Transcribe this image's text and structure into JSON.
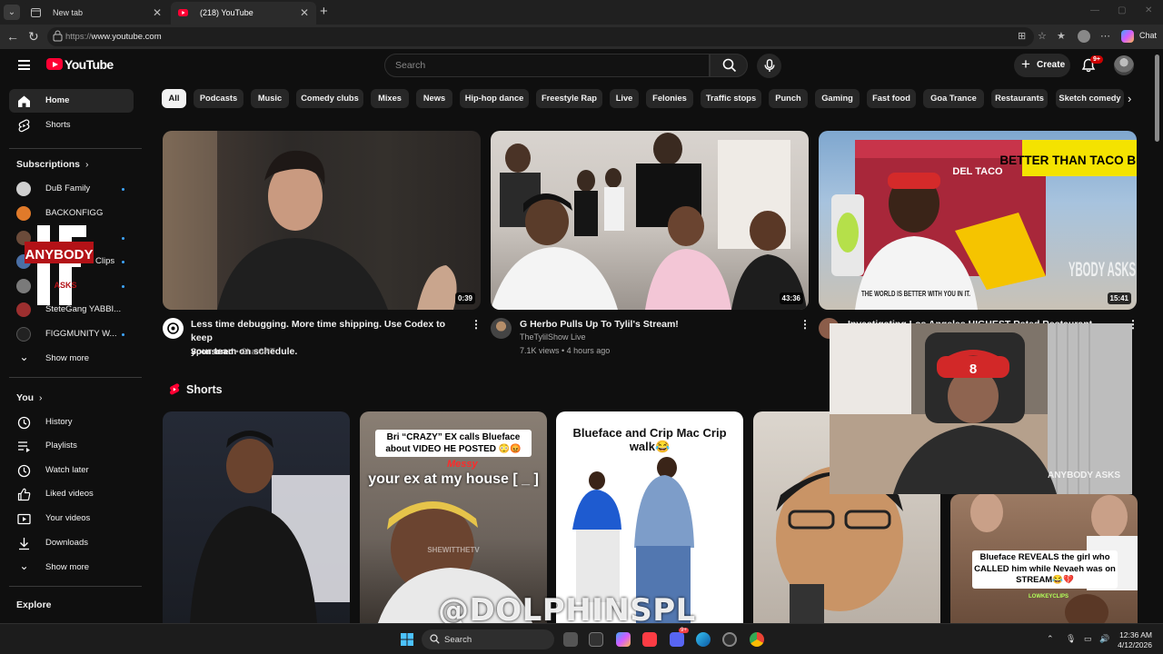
{
  "browser": {
    "tabs": [
      {
        "label": "New tab",
        "active": false
      },
      {
        "label": "(218) YouTube",
        "active": true
      }
    ],
    "url_scheme": "https://",
    "url_host": "www.youtube.com",
    "chat_label": "Chat"
  },
  "header": {
    "logo_text": "YouTube",
    "search_placeholder": "Search",
    "create_label": "Create",
    "notification_badge": "9+"
  },
  "sidebar": {
    "main": [
      {
        "label": "Home",
        "icon": "home-icon",
        "active": true
      },
      {
        "label": "Shorts",
        "icon": "shorts-icon",
        "active": false
      }
    ],
    "subscriptions_heading": "Subscriptions",
    "subscriptions": [
      {
        "label": "DuB Family",
        "color": "#c8c8c8"
      },
      {
        "label": "BACKONFIGG",
        "color": "#e07a2a"
      },
      {
        "label": "",
        "color": "#6b4b3a"
      },
      {
        "label": "Clips",
        "color": "#4a6fa5"
      },
      {
        "label": "",
        "color": "#7a7a7a"
      },
      {
        "label": "SteteGang YABBI...",
        "color": "#9c2f2f"
      },
      {
        "label": "FIGGMUNITY W...",
        "color": "#222222"
      }
    ],
    "subs_show_more": "Show more",
    "you_heading": "You",
    "you_items": [
      {
        "label": "History",
        "icon": "history-icon"
      },
      {
        "label": "Playlists",
        "icon": "playlists-icon"
      },
      {
        "label": "Watch later",
        "icon": "watch-later-icon"
      },
      {
        "label": "Liked videos",
        "icon": "thumbs-up-icon"
      },
      {
        "label": "Your videos",
        "icon": "your-videos-icon"
      },
      {
        "label": "Downloads",
        "icon": "download-icon"
      }
    ],
    "you_show_more": "Show more",
    "explore_heading": "Explore",
    "overlay_logo": {
      "top_text": "IF",
      "main_text": "ANYBODY",
      "bottom_text": "ASKS"
    }
  },
  "chips": [
    "All",
    "Podcasts",
    "Music",
    "Comedy clubs",
    "Mixes",
    "News",
    "Hip-hop dance",
    "Freestyle Rap",
    "Live",
    "Felonies",
    "Traffic stops",
    "Punch",
    "Gaming",
    "Fast food",
    "Goa Trance",
    "Restaurants",
    "Sketch comedy"
  ],
  "videos": [
    {
      "title_line1": "Less time debugging. More time shipping. Use Codex to keep",
      "title_line2": "your team on schedule.",
      "sponsored": "Sponsored",
      "channel": "ChatGPT",
      "duration": "0:39"
    },
    {
      "title_line1": "G Herbo Pulls Up To Tylil's Stream!",
      "title_line2": "",
      "channel": "TheTylilShow Live",
      "meta": "7.1K views • 4 hours ago",
      "duration": "43:36"
    },
    {
      "title_line1": "Investigating Los Angeles HIGHEST Rated Restaurant",
      "title_line2": "",
      "channel": "",
      "meta": "",
      "duration": "15:41",
      "thumb_text": "BETTER THAN TACO BELL",
      "sign_text": "DEL TACO",
      "shirt_text": "THE WORLD IS BETTER WITH YOU IN IT.",
      "thumb_watermark": "YBODY ASKS"
    }
  ],
  "shorts_heading": "Shorts",
  "shorts": [
    {
      "caption": "",
      "overlay": ""
    },
    {
      "caption": "Bri “CRAZY” EX calls Blueface about VIDEO HE POSTED 😳😡",
      "overlay": "your ex at my house [ _ ]",
      "tag": "Messy",
      "watermark": "SHEWITTHETV"
    },
    {
      "caption": "Blueface and Crip Mac Crip walk😂",
      "overlay": ""
    },
    {
      "caption": "",
      "overlay": ""
    },
    {
      "caption": "Blueface REVEALS the girl who CALLED him while Nevaeh was on STREAM😂💔",
      "overlay": "",
      "tag": "LOWKEYCLIPS"
    }
  ],
  "pip": {
    "logo_text": "ANYBODY ASKS",
    "cap_text": "8"
  },
  "watermark": "@DOLPHINSPL",
  "taskbar": {
    "search_label": "Search",
    "time": "12:36 AM",
    "date": "4/12/2026",
    "discord_badge": "9+"
  },
  "colors": {
    "accent": "#ff0033",
    "chip_selected": "#f1f1f1",
    "badge": "#cc0000",
    "blue_dot": "#3ea6ff"
  }
}
